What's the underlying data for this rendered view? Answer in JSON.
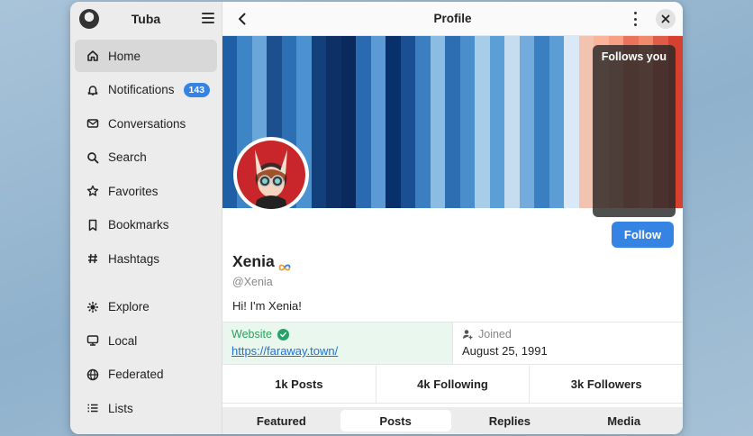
{
  "sidebar": {
    "title": "Tuba",
    "items": [
      {
        "label": "Home",
        "icon": "home-icon",
        "active": true
      },
      {
        "label": "Notifications",
        "icon": "bell-icon",
        "badge": "143"
      },
      {
        "label": "Conversations",
        "icon": "mail-icon"
      },
      {
        "label": "Search",
        "icon": "search-icon"
      },
      {
        "label": "Favorites",
        "icon": "star-icon"
      },
      {
        "label": "Bookmarks",
        "icon": "bookmark-icon"
      },
      {
        "label": "Hashtags",
        "icon": "hashtag-icon"
      },
      {
        "label": "Explore",
        "icon": "explore-icon"
      },
      {
        "label": "Local",
        "icon": "local-icon"
      },
      {
        "label": "Federated",
        "icon": "globe-icon"
      },
      {
        "label": "Lists",
        "icon": "list-icon"
      }
    ]
  },
  "header": {
    "title": "Profile"
  },
  "profile": {
    "follows_you": "Follows you",
    "follow_label": "Follow",
    "display_name": "Xenia",
    "handle": "@Xenia",
    "bio": "Hi! I'm Xenia!",
    "fields": {
      "website_label": "Website",
      "website_value": "https://faraway.town/",
      "joined_label": "Joined",
      "joined_value": "August 25, 1991"
    },
    "stats": {
      "posts": "1k Posts",
      "following": "4k Following",
      "followers": "3k Followers"
    }
  },
  "tabs": [
    {
      "label": "Featured"
    },
    {
      "label": "Posts",
      "active": true
    },
    {
      "label": "Replies"
    },
    {
      "label": "Media"
    }
  ],
  "colors": {
    "accent": "#3584e4",
    "verified": "#26a269",
    "banner_stripes": [
      "#1f5fa6",
      "#3d85c6",
      "#6aa6d9",
      "#1b4f8e",
      "#2c6fb3",
      "#4b93d0",
      "#12407a",
      "#0d3166",
      "#0a2a5e",
      "#2a6ab0",
      "#5b9ad5",
      "#08306b",
      "#1a4f93",
      "#3c7fc0",
      "#8bbde3",
      "#2d6db2",
      "#4a8fcc",
      "#a7cde9",
      "#5c9ed6",
      "#c6ddf0",
      "#73acdc",
      "#3a7fc2",
      "#5d9dd5",
      "#dbe9f6",
      "#f2c4b0",
      "#fbb49a",
      "#f7a086",
      "#e9745b",
      "#f08a6b",
      "#e05c44",
      "#d6402e"
    ]
  }
}
